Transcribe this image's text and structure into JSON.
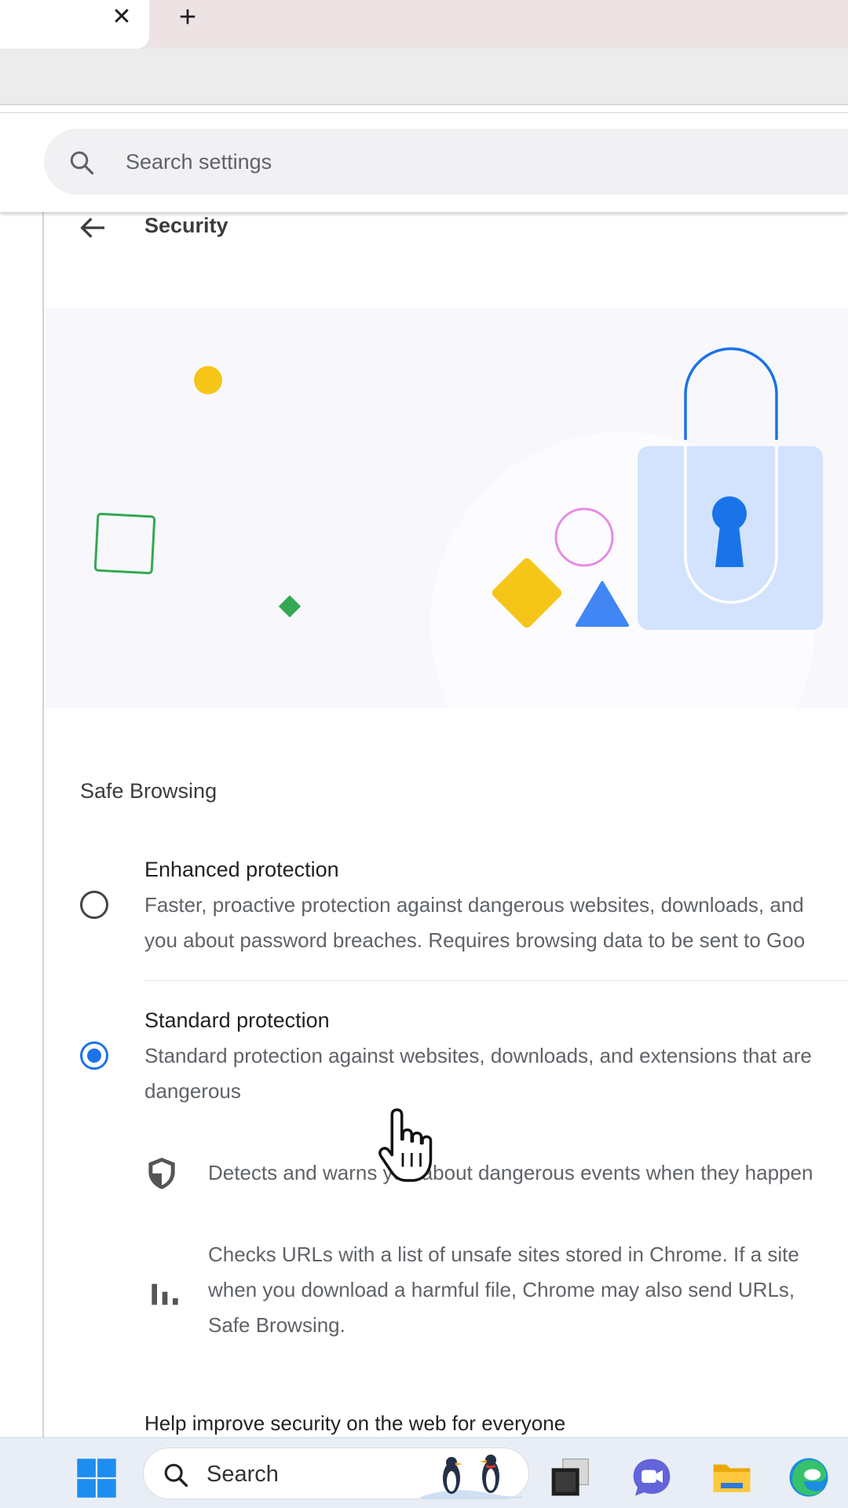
{
  "browser": {
    "tab_close_glyph": "✕",
    "new_tab_glyph": "+"
  },
  "settings": {
    "search_placeholder": "Search settings",
    "page_title": "Security"
  },
  "safe_browsing": {
    "section_title": "Safe Browsing",
    "options": [
      {
        "label": "Enhanced protection",
        "desc_lines": [
          "Faster, proactive protection against dangerous websites, downloads, and",
          "you about password breaches. Requires browsing data to be sent to Goo"
        ],
        "selected": false
      },
      {
        "label": "Standard protection",
        "desc_lines": [
          "Standard protection against websites, downloads, and extensions that are",
          "dangerous"
        ],
        "selected": true
      }
    ],
    "features": [
      {
        "icon": "shield-icon",
        "lines": [
          "Detects and warns you about dangerous events when they happen"
        ]
      },
      {
        "icon": "bar-chart-icon",
        "lines": [
          "Checks URLs with a list of unsafe sites stored in Chrome. If a site",
          "when you download a harmful file, Chrome may also send URLs,",
          "Safe Browsing."
        ]
      }
    ],
    "help_text": "Help improve security on the web for everyone"
  },
  "taskbar": {
    "search_label": "Search",
    "apps": [
      "windows-start-icon",
      "task-view-icon",
      "teams-chat-icon",
      "file-explorer-icon",
      "edge-browser-icon"
    ]
  },
  "colors": {
    "accent": "#1a73e8",
    "illustration_yellow": "#f5c518",
    "illustration_green": "#34a853",
    "illustration_blue": "#4285f4",
    "illustration_pink": "#e58ce5",
    "lock_body": "#d3e3fd"
  }
}
